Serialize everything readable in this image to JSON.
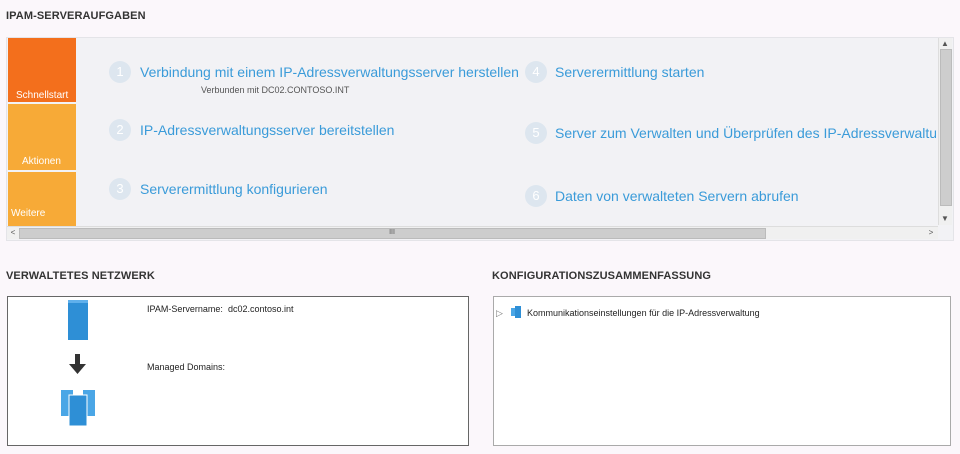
{
  "header": {
    "title": "IPAM-SERVERAUFGABEN"
  },
  "tabs": [
    {
      "label": "Schnellstart"
    },
    {
      "label": "Aktionen"
    },
    {
      "label": "Weitere"
    }
  ],
  "steps": [
    {
      "num": "1",
      "label": "Verbindung mit einem IP-Adressverwaltungsserver herstellen",
      "sub": "Verbunden mit DC02.CONTOSO.INT"
    },
    {
      "num": "2",
      "label": "IP-Adressverwaltungsserver bereitstellen"
    },
    {
      "num": "3",
      "label": "Serverermittlung konfigurieren"
    },
    {
      "num": "4",
      "label": "Serverermittlung starten"
    },
    {
      "num": "5",
      "label": "Server zum Verwalten und Überprüfen des IP-Adressverwaltungsz"
    },
    {
      "num": "6",
      "label": "Daten von verwalteten Servern abrufen"
    }
  ],
  "scroll": {
    "grip": "III",
    "up": "▲",
    "down": "▼",
    "left": "<",
    "right": ">"
  },
  "network": {
    "title": "VERWALTETES NETZWERK",
    "server_label": "IPAM-Servername:",
    "server_value": "dc02.contoso.int",
    "domains_label": "Managed Domains:",
    "arrow": "🡓"
  },
  "config": {
    "title": "KONFIGURATIONSZUSAMMENFASSUNG",
    "expander": "▷",
    "item": "Kommunikationseinstellungen für die IP-Adressverwaltung"
  },
  "colors": {
    "accent": "#3a9bd9",
    "tab_active": "#f36f1c",
    "tab_inactive": "#f7aa37",
    "icon": "#2e8fd6"
  }
}
